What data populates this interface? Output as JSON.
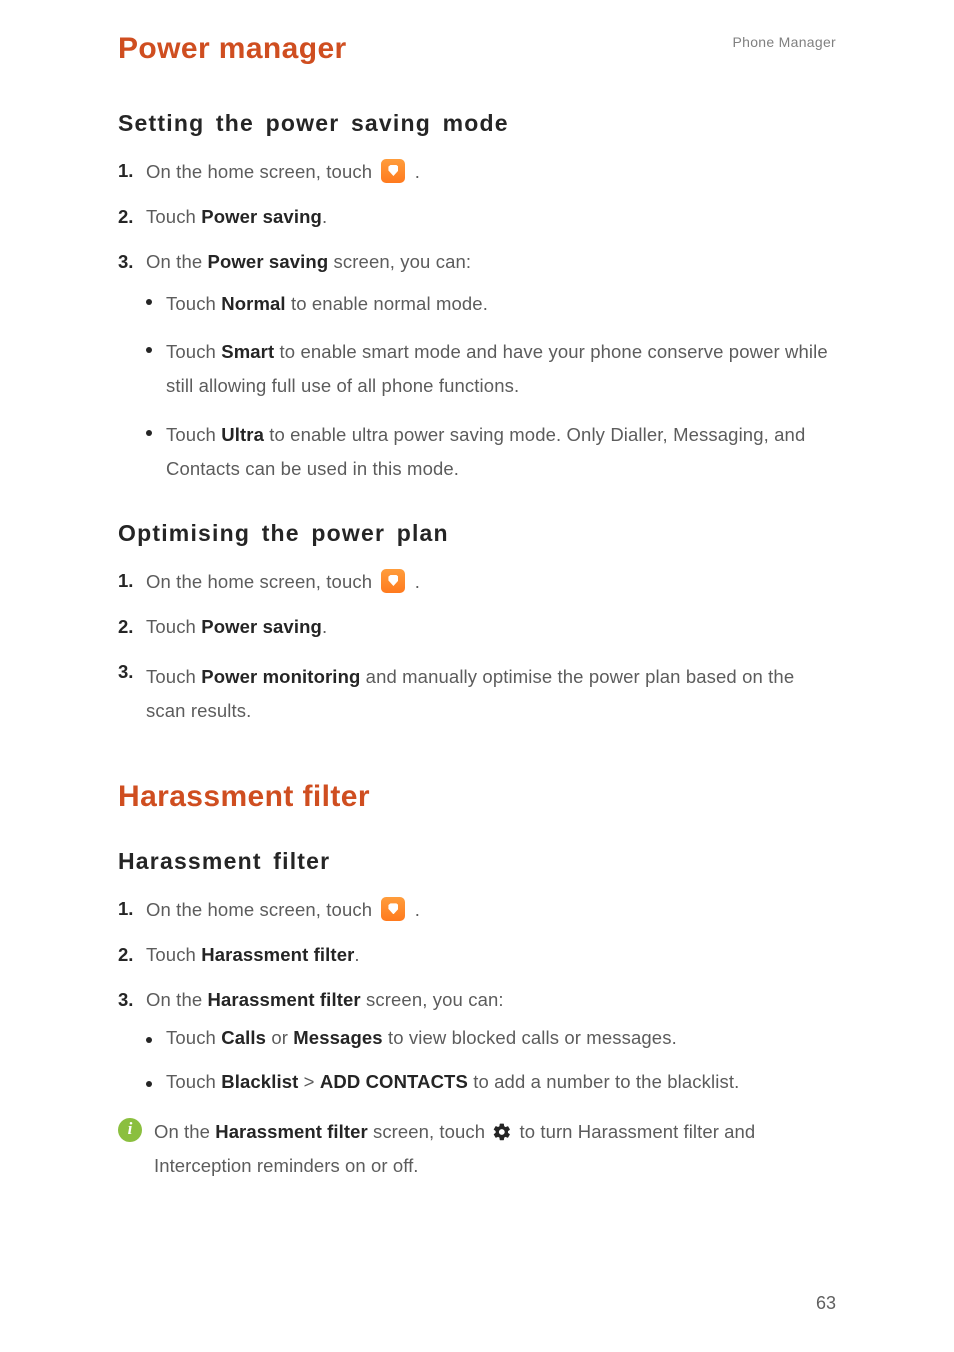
{
  "header": {
    "running": "Phone Manager"
  },
  "footer": {
    "page_number": "63"
  },
  "h1_power": "Power manager",
  "h1_harassment": "Harassment filter",
  "power_saving": {
    "title": "Setting the power saving mode",
    "steps": {
      "s1_pre": "On the home screen, touch ",
      "s1_post": ".",
      "s2_pre": "Touch ",
      "s2_bold": "Power saving",
      "s2_post": ".",
      "s3_pre": "On the ",
      "s3_bold": "Power saving",
      "s3_post": " screen, you can:",
      "bullets": {
        "b1_pre": "Touch ",
        "b1_bold": "Normal",
        "b1_post": " to enable normal mode.",
        "b2_pre": "Touch ",
        "b2_bold": "Smart",
        "b2_post": " to enable smart mode and have your phone conserve power while still allowing full use of all phone functions.",
        "b3_pre": "Touch ",
        "b3_bold": "Ultra",
        "b3_post": " to enable ultra power saving mode. Only Dialler, Messaging, and Contacts can be used in this mode."
      }
    }
  },
  "power_plan": {
    "title": "Optimising the power plan",
    "steps": {
      "s1_pre": "On the home screen, touch ",
      "s1_post": ".",
      "s2_pre": "Touch ",
      "s2_bold": "Power saving",
      "s2_post": ".",
      "s3_pre": "Touch ",
      "s3_bold": "Power monitoring",
      "s3_post": " and manually optimise the power plan based on the scan results."
    }
  },
  "harassment": {
    "sub_title": "Harassment filter",
    "steps": {
      "s1_pre": "On the home screen, touch ",
      "s1_post": ".",
      "s2_pre": "Touch ",
      "s2_bold": "Harassment filter",
      "s2_post": ".",
      "s3_pre": "On the ",
      "s3_bold": "Harassment filter",
      "s3_post": " screen, you can:",
      "bullets": {
        "b1_pre": "Touch ",
        "b1_bold1": "Calls",
        "b1_mid": " or ",
        "b1_bold2": "Messages",
        "b1_post": " to view blocked calls or messages.",
        "b2_pre": "Touch ",
        "b2_bold1": "Blacklist",
        "b2_mid": " > ",
        "b2_bold2": "ADD CONTACTS",
        "b2_post": " to add a number to the blacklist."
      }
    },
    "note": {
      "pre": "On the ",
      "bold": "Harassment filter",
      "mid": " screen, touch ",
      "post": " to turn Harassment filter and Interception reminders on or off."
    }
  }
}
